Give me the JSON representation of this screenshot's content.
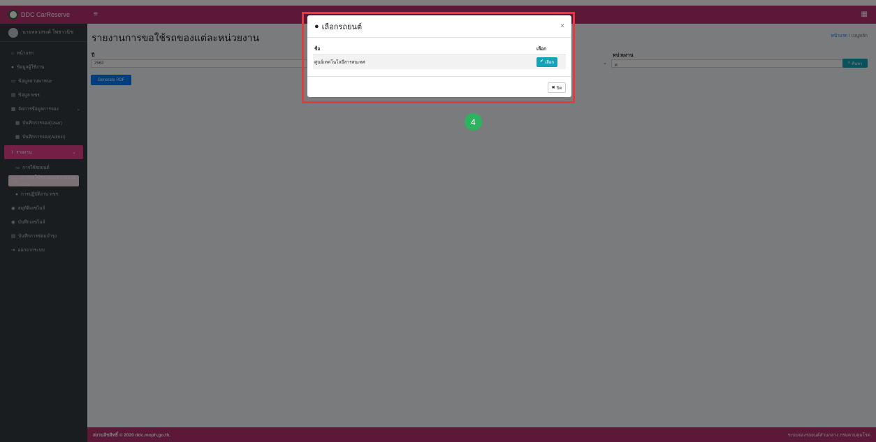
{
  "app": {
    "brand": "DDC CarReserve",
    "user": "นายหลวงรงค์ โพธาวนิช"
  },
  "sidebar": {
    "items": [
      {
        "label": "หน้าแรก"
      },
      {
        "label": "ข้อมูลผู้ใช้งาน"
      },
      {
        "label": "ข้อมูลยานพาหนะ"
      },
      {
        "label": "ข้อมูล พขร."
      },
      {
        "label": "จัดการข้อมูลการจอง"
      },
      {
        "label": "บันทึกการจอง(User)"
      },
      {
        "label": "บันทึกการจอง(Admin)"
      },
      {
        "label": "รายงาน"
      },
      {
        "label": "การใช้รถยนต์"
      },
      {
        "label": "การขอใช้รถของแต่ละหน่วยงาน"
      },
      {
        "label": "การปฏิบัติงาน พขร."
      },
      {
        "label": "สมุดัติเลขไมล์"
      },
      {
        "label": "บันทึกเลขไมล์"
      },
      {
        "label": "บันทึกการซ่อมบำรุง"
      },
      {
        "label": "ออกจากระบบ"
      }
    ]
  },
  "page": {
    "title": "รายงานการขอใช้รถของแต่ละหน่วยงาน",
    "breadcrumb_home": "หน้าแรก",
    "breadcrumb_current": "เมนูหลัก",
    "year_label": "ปี",
    "year_value": "2563",
    "unit_label": "หน่วยงาน",
    "unit_value": "ศ",
    "generate_pdf": "Generate PDF",
    "search_button": "ค้นหา"
  },
  "footer": {
    "copyright": "สงวนลิขสิทธิ์ © 2020 ddc.moph.go.th.",
    "org": "ระบบจองรถยนต์ส่วนกลาง กรมควบคุมโรค"
  },
  "modal": {
    "title": "เลือกรถยนต์",
    "close_x": "×",
    "col_name": "ชื่อ",
    "col_select": "เลือก",
    "rows": [
      {
        "name": "ศูนย์เทคโนโลยีสารสนเทศ",
        "action": "เลือก"
      }
    ],
    "close_button": "ปิด"
  },
  "step_marker": "4"
}
